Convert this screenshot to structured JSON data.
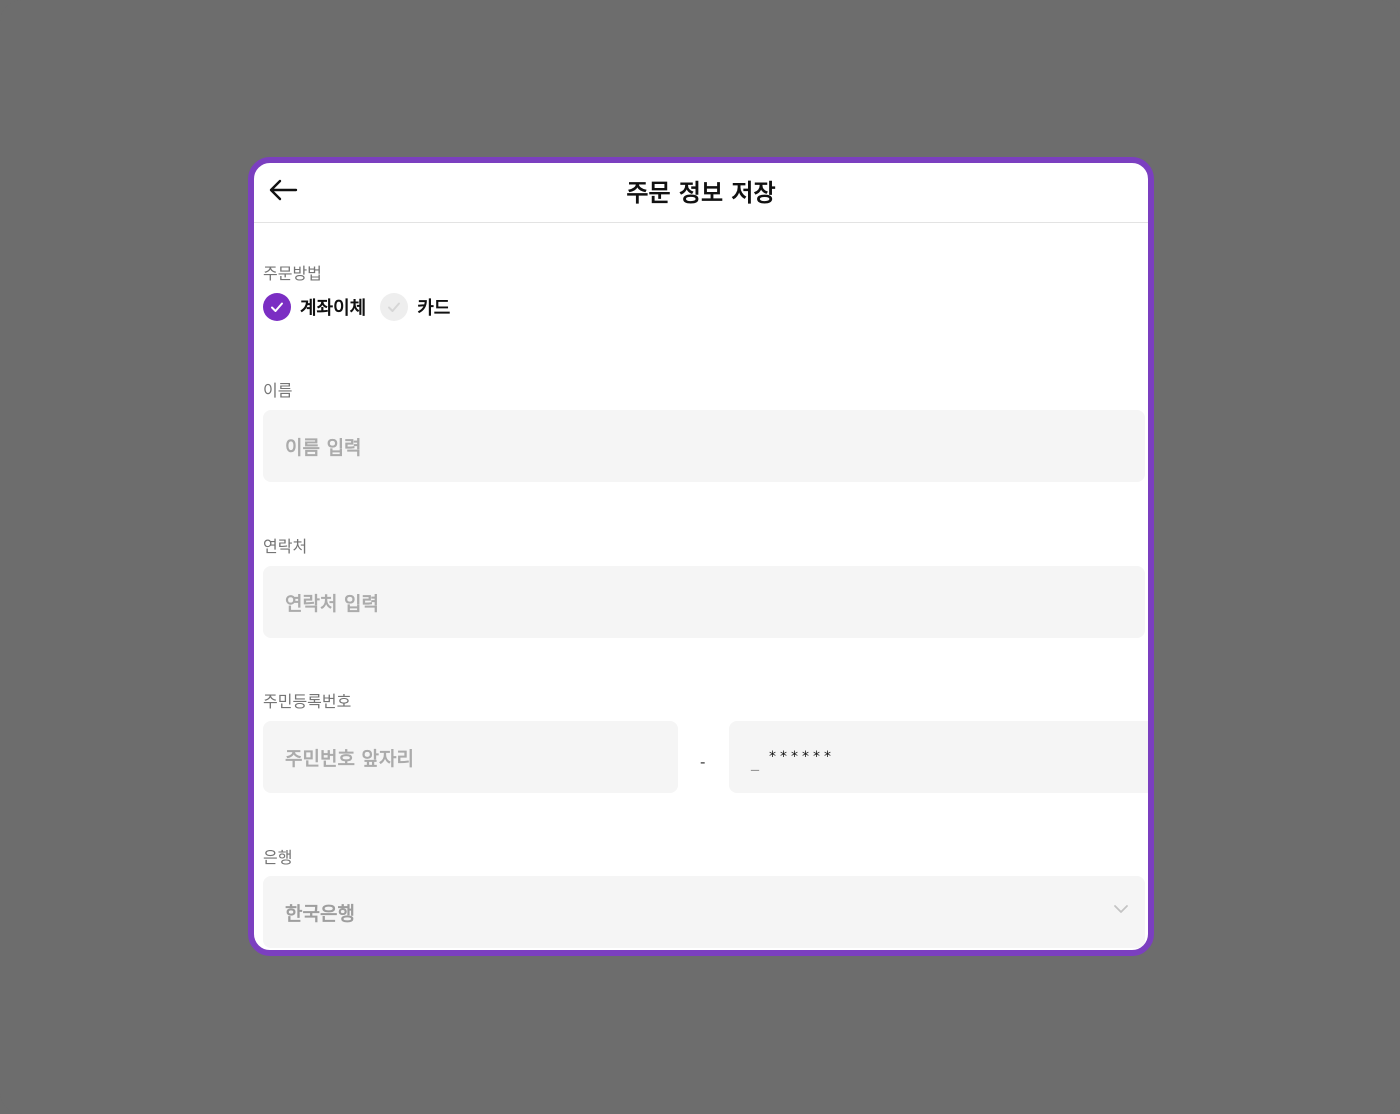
{
  "header": {
    "title": "주문 정보 저장"
  },
  "payment": {
    "label": "주문방법",
    "options": [
      {
        "label": "계좌이체",
        "selected": true
      },
      {
        "label": "카드",
        "selected": false
      }
    ]
  },
  "name": {
    "label": "이름",
    "placeholder": "이름 입력"
  },
  "contact": {
    "label": "연락처",
    "placeholder": "연락처 입력"
  },
  "rrn": {
    "label": "주민등록번호",
    "front_placeholder": "주민번호 앞자리",
    "separator": "-",
    "cursor": "_",
    "back_mask": "******"
  },
  "bank": {
    "label": "은행",
    "selected": "한국은행"
  },
  "colors": {
    "accent": "#7b2ec3",
    "border": "#7b3fc0",
    "backdrop": "#6d6d6d"
  }
}
